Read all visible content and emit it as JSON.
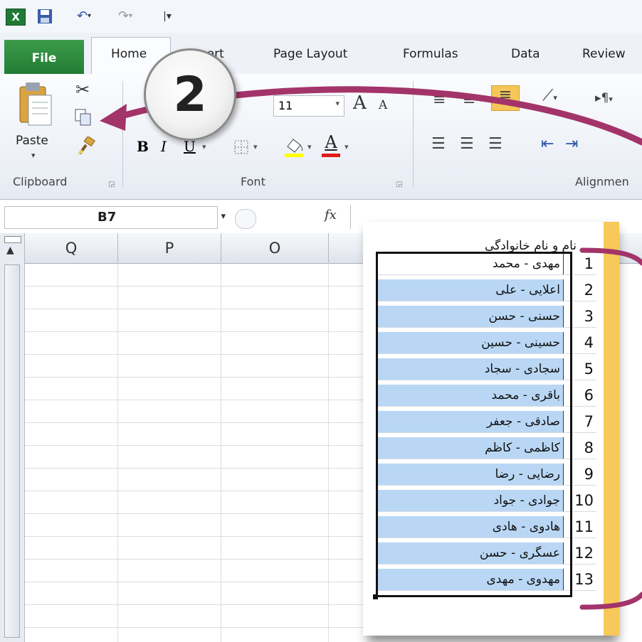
{
  "qat": {
    "excel_icon": "excel-icon",
    "save_icon": "save-icon",
    "undo_icon": "undo-icon",
    "redo_icon": "redo-icon",
    "customize_icon": "customize-icon"
  },
  "ribbon_tabs": {
    "file": "File",
    "home": "Home",
    "insert": "Insert",
    "page_layout": "Page Layout",
    "formulas": "Formulas",
    "data": "Data",
    "review": "Review"
  },
  "clipboard": {
    "paste": "Paste",
    "label": "Clipboard"
  },
  "font": {
    "size": "11",
    "bold": "B",
    "italic": "I",
    "underline": "U",
    "color_letter": "A",
    "grow_letter": "A",
    "shrink_letter": "A",
    "label": "Font"
  },
  "alignment": {
    "label": "Alignmen"
  },
  "formula_bar": {
    "name_box": "B7",
    "fx": "fx"
  },
  "columns": [
    "Q",
    "P",
    "O"
  ],
  "callout": {
    "number": "2"
  },
  "list": {
    "header": "نام و نام خانوادگی",
    "rows": [
      {
        "num": "1",
        "name": "مهدی - محمد"
      },
      {
        "num": "2",
        "name": "اعلایی - علی"
      },
      {
        "num": "3",
        "name": "حسنی - حسن"
      },
      {
        "num": "4",
        "name": "حسینی - حسین"
      },
      {
        "num": "5",
        "name": "سجادی - سجاد"
      },
      {
        "num": "6",
        "name": "باقری - محمد"
      },
      {
        "num": "7",
        "name": "صادقی - جعفر"
      },
      {
        "num": "8",
        "name": "کاظمی - کاظم"
      },
      {
        "num": "9",
        "name": "رضایی - رضا"
      },
      {
        "num": "10",
        "name": "جوادی - جواد"
      },
      {
        "num": "11",
        "name": "هادوی - هادی"
      },
      {
        "num": "12",
        "name": "عسگری - حسن"
      },
      {
        "num": "13",
        "name": "مهدوی - مهدی"
      }
    ]
  },
  "colors": {
    "selection": "#b9d7f4",
    "file_tab": "#2e8b3c",
    "arrow": "#a3346a",
    "highlight": "#f7c85a"
  }
}
